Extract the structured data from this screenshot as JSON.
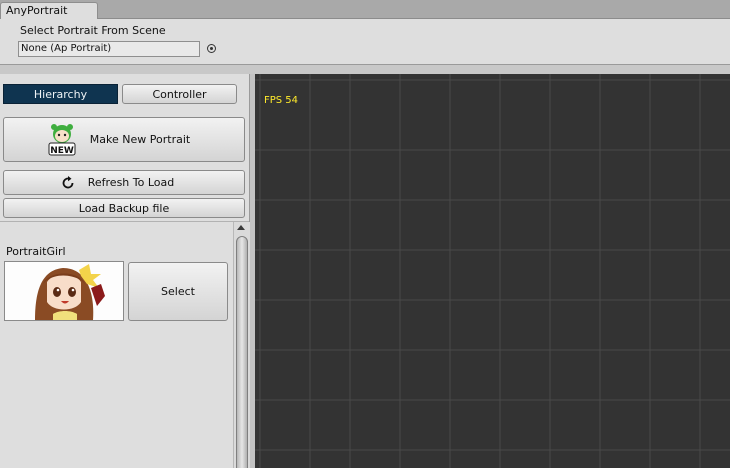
{
  "window": {
    "tab_title": "AnyPortrait"
  },
  "header": {
    "select_label": "Select Portrait From Scene",
    "object_field_value": "None (Ap Portrait)"
  },
  "left_panel": {
    "tabs": [
      {
        "label": "Hierarchy",
        "selected": true
      },
      {
        "label": "Controller",
        "selected": false
      }
    ],
    "buttons": {
      "make_new": "Make New Portrait",
      "new_icon_text": "NEW",
      "refresh": "Refresh To Load",
      "load_backup": "Load Backup file"
    },
    "portrait_list": [
      {
        "name": "PortraitGirl",
        "select_label": "Select"
      }
    ]
  },
  "viewport": {
    "fps_text": "FPS 54"
  },
  "colors": {
    "selected_tab": "#0f3450",
    "viewport_bg": "#333333",
    "grid_line": "#4a4a4a",
    "fps_text": "#ffea2b"
  }
}
